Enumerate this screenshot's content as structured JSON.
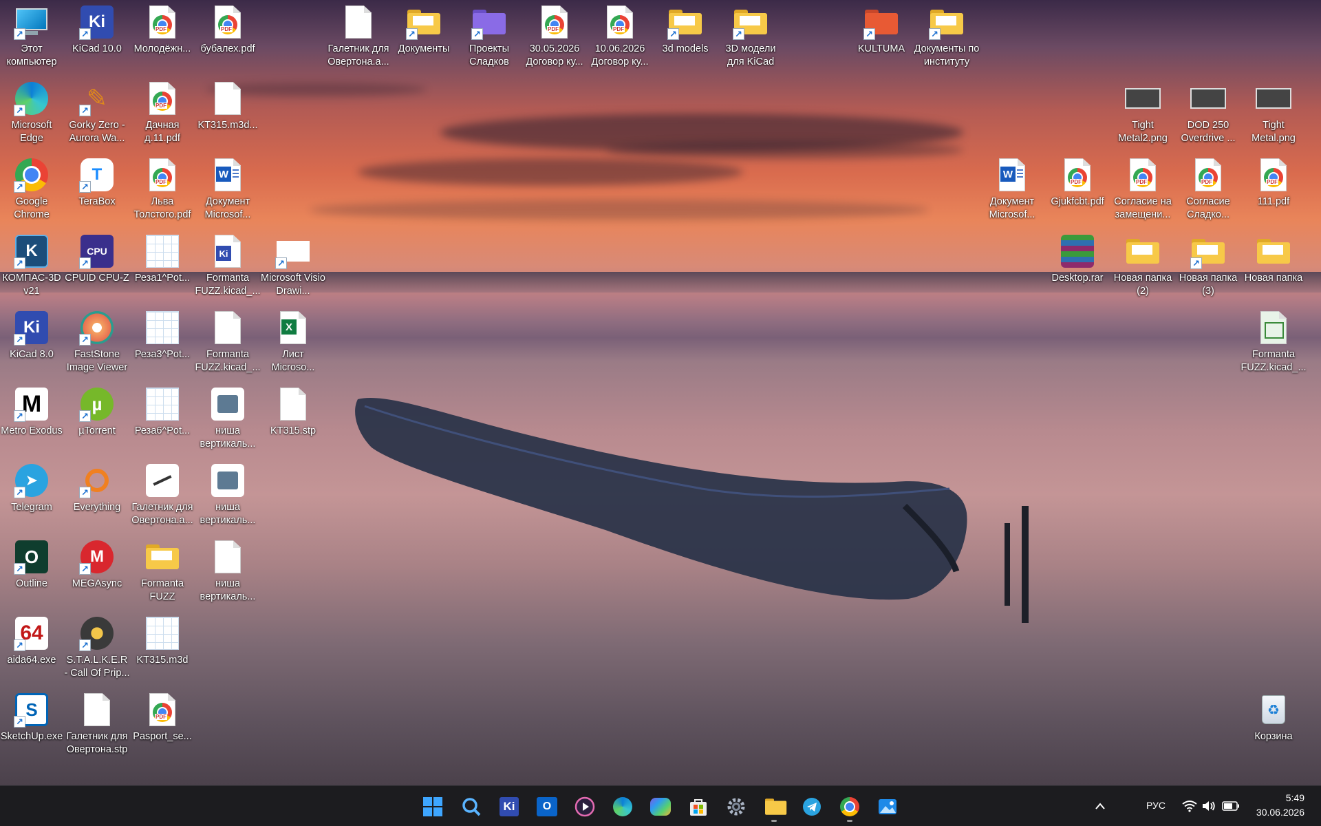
{
  "desktop": {
    "icons": [
      {
        "label": "Этот компьютер",
        "icon": "monitor-icon"
      },
      {
        "label": "KiCad 10.0",
        "icon": "kicad-icon"
      },
      {
        "label": "Молодёжн...",
        "icon": "pdf-file-icon"
      },
      {
        "label": "бубалех.pdf",
        "icon": "pdf-file-icon"
      },
      {
        "label": "Галетник для Овертона.a...",
        "icon": "blank-file-icon"
      },
      {
        "label": "Документы",
        "icon": "folder-icon"
      },
      {
        "label": "Проекты Сладков",
        "icon": "folder-purple-icon"
      },
      {
        "label": "30.05.2026 Договор ку...",
        "icon": "pdf-file-icon"
      },
      {
        "label": "10.06.2026 Договор ку...",
        "icon": "pdf-file-icon"
      },
      {
        "label": "3d models",
        "icon": "folder-icon"
      },
      {
        "label": "3D модели для KiCad",
        "icon": "folder-icon"
      },
      {
        "label": "KULTUMA",
        "icon": "folder-red-icon"
      },
      {
        "label": "Документы по институту",
        "icon": "folder-icon"
      },
      {
        "label": "Microsoft Edge",
        "icon": "edge-icon"
      },
      {
        "label": "Gorky Zero - Aurora Wa...",
        "icon": "game-icon"
      },
      {
        "label": "Дачная д.11.pdf",
        "icon": "pdf-file-icon"
      },
      {
        "label": "KT315.m3d...",
        "icon": "blank-file-icon"
      },
      {
        "label": "Tight Metal2.png",
        "icon": "image-thumb-icon"
      },
      {
        "label": "DOD 250 Overdrive ...",
        "icon": "image-thumb-icon"
      },
      {
        "label": "Tight Metal.png",
        "icon": "image-thumb-icon"
      },
      {
        "label": "Google Chrome",
        "icon": "chrome-icon"
      },
      {
        "label": "TeraBox",
        "icon": "terabox-icon"
      },
      {
        "label": "Льва Толстого.pdf",
        "icon": "pdf-file-icon"
      },
      {
        "label": "Документ Microsof...",
        "icon": "word-icon"
      },
      {
        "label": "Документ Microsof...",
        "icon": "word-icon"
      },
      {
        "label": "Gjukfcbt.pdf",
        "icon": "pdf-file-icon"
      },
      {
        "label": "Согласие на замещени...",
        "icon": "pdf-file-icon"
      },
      {
        "label": "Согласие Сладко...",
        "icon": "pdf-file-icon"
      },
      {
        "label": "111.pdf",
        "icon": "pdf-file-icon"
      },
      {
        "label": "КОМПАС-3D v21",
        "icon": "kompas-icon"
      },
      {
        "label": "CPUID CPU-Z",
        "icon": "cpuz-icon"
      },
      {
        "label": "Реза1^Pot...",
        "icon": "wireframe-icon"
      },
      {
        "label": "Formanta FUZZ.kicad_...",
        "icon": "kicad-file-icon"
      },
      {
        "label": "Microsoft Visio Drawi...",
        "icon": "visio-icon"
      },
      {
        "label": "Desktop.rar",
        "icon": "rar-icon"
      },
      {
        "label": "Новая папка (2)",
        "icon": "folder-icon"
      },
      {
        "label": "Новая папка (3)",
        "icon": "folder-icon"
      },
      {
        "label": "Новая папка",
        "icon": "folder-icon"
      },
      {
        "label": "KiCad 8.0",
        "icon": "kicad-icon"
      },
      {
        "label": "FastStone Image Viewer",
        "icon": "faststone-icon"
      },
      {
        "label": "Реза3^Pot...",
        "icon": "wireframe-icon"
      },
      {
        "label": "Formanta FUZZ.kicad_...",
        "icon": "blank-file-icon"
      },
      {
        "label": "Лист Microso...",
        "icon": "excel-icon"
      },
      {
        "label": "Formanta FUZZ.kicad_...",
        "icon": "kicad-sheet-icon"
      },
      {
        "label": "Metro Exodus",
        "icon": "metro-icon"
      },
      {
        "label": "µTorrent",
        "icon": "utorrent-icon"
      },
      {
        "label": "Реза6^Pot...",
        "icon": "wireframe-icon"
      },
      {
        "label": "ниша вертикаль...",
        "icon": "cad-part-icon"
      },
      {
        "label": "KT315.stp",
        "icon": "blank-file-icon"
      },
      {
        "label": "Telegram",
        "icon": "telegram-icon"
      },
      {
        "label": "Everything",
        "icon": "everything-icon"
      },
      {
        "label": "Галетник для Овертона.a...",
        "icon": "cad-drawing-icon"
      },
      {
        "label": "ниша вертикаль...",
        "icon": "cad-part-icon"
      },
      {
        "label": "Outline",
        "icon": "outline-icon"
      },
      {
        "label": "MEGAsync",
        "icon": "mega-icon"
      },
      {
        "label": "Formanta FUZZ",
        "icon": "folder-icon"
      },
      {
        "label": "ниша вертикаль...",
        "icon": "blank-file-icon"
      },
      {
        "label": "aida64.exe",
        "icon": "aida64-icon"
      },
      {
        "label": "S.T.A.L.K.E.R - Call Of Prip...",
        "icon": "stalker-icon"
      },
      {
        "label": "KT315.m3d",
        "icon": "wireframe-icon"
      },
      {
        "label": "SketchUp.exe",
        "icon": "sketchup-icon"
      },
      {
        "label": "Галетник для Овертона.stp",
        "icon": "blank-file-icon"
      },
      {
        "label": "Pasport_se...",
        "icon": "pdf-file-icon"
      },
      {
        "label": "Корзина",
        "icon": "recycle-bin-icon"
      }
    ]
  },
  "taskbar": {
    "apps": [
      {
        "name": "start-button",
        "icon": "windows-logo-icon"
      },
      {
        "name": "taskbar-search",
        "icon": "search-icon"
      },
      {
        "name": "taskbar-kicad",
        "icon": "kicad-icon"
      },
      {
        "name": "taskbar-outlook",
        "icon": "outlook-icon"
      },
      {
        "name": "taskbar-media-player",
        "icon": "media-player-icon"
      },
      {
        "name": "taskbar-edge",
        "icon": "edge-icon"
      },
      {
        "name": "taskbar-m365",
        "icon": "m365-icon"
      },
      {
        "name": "taskbar-store",
        "icon": "store-icon"
      },
      {
        "name": "taskbar-settings",
        "icon": "gear-icon"
      },
      {
        "name": "taskbar-explorer",
        "icon": "folder-icon"
      },
      {
        "name": "taskbar-telegram",
        "icon": "telegram-icon"
      },
      {
        "name": "taskbar-chrome",
        "icon": "chrome-icon"
      },
      {
        "name": "taskbar-photos",
        "icon": "photos-icon"
      }
    ],
    "tray": {
      "language": "РУС",
      "time": "5:49",
      "date": "30.06.2026"
    }
  }
}
